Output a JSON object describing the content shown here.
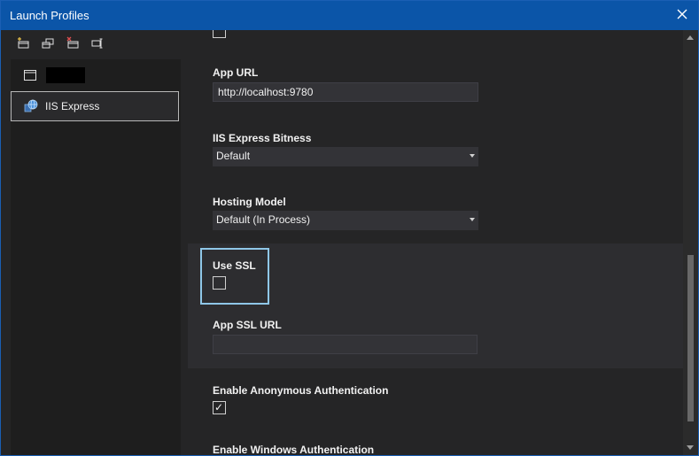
{
  "window": {
    "title": "Launch Profiles"
  },
  "toolbar": {
    "icons": [
      "new-profile-icon",
      "copy-profile-icon",
      "delete-profile-icon",
      "rename-profile-icon"
    ]
  },
  "profiles": [
    {
      "label": "",
      "icon": "window-icon",
      "redacted": true
    },
    {
      "label": "IIS Express",
      "icon": "iis-globe-icon",
      "selected": true
    }
  ],
  "fields": {
    "app_url": {
      "label": "App URL",
      "value": "http://localhost:9780"
    },
    "bitness": {
      "label": "IIS Express Bitness",
      "value": "Default"
    },
    "hosting_model": {
      "label": "Hosting Model",
      "value": "Default (In Process)"
    },
    "use_ssl": {
      "label": "Use SSL",
      "checked": false
    },
    "app_ssl_url": {
      "label": "App SSL URL",
      "value": ""
    },
    "anon_auth": {
      "label": "Enable Anonymous Authentication",
      "checked": true
    },
    "windows_auth": {
      "label": "Enable Windows Authentication"
    },
    "top_checkbox": {
      "checked": false
    }
  },
  "colors": {
    "titlebar": "#0b55a8",
    "background": "#252526",
    "focus": "#8fc7e8"
  }
}
